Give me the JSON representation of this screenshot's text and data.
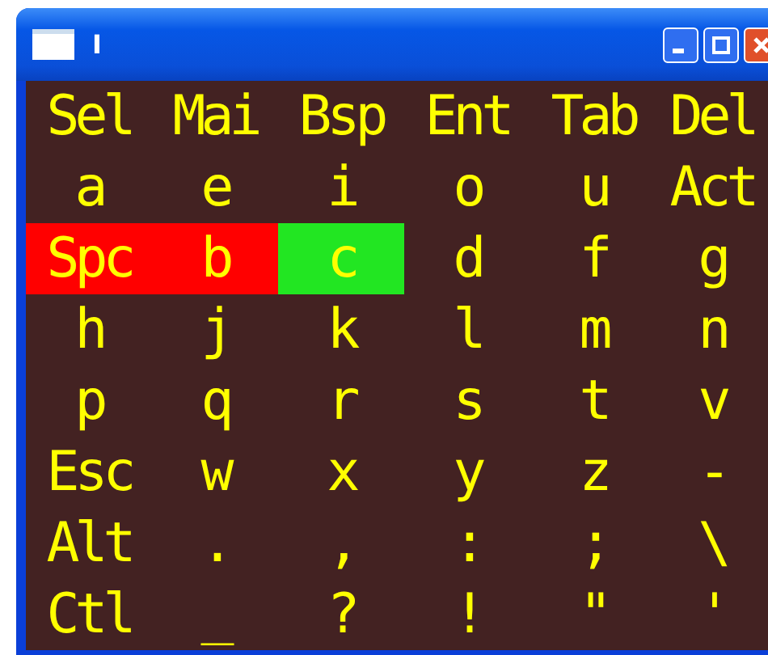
{
  "window": {
    "title": "I"
  },
  "rows": [
    {
      "cells": [
        {
          "text": "Sel"
        },
        {
          "text": "Mai"
        },
        {
          "text": "Bsp"
        },
        {
          "text": "Ent"
        },
        {
          "text": "Tab"
        },
        {
          "text": "Del"
        }
      ]
    },
    {
      "cells": [
        {
          "text": "a"
        },
        {
          "text": "e"
        },
        {
          "text": "i"
        },
        {
          "text": "o"
        },
        {
          "text": "u"
        },
        {
          "text": "Act"
        }
      ]
    },
    {
      "cells": [
        {
          "text": "Spc",
          "color": "#ff0000"
        },
        {
          "text": "b",
          "color": "#ff0000"
        },
        {
          "text": "c",
          "color": "#22e622"
        },
        {
          "text": "d"
        },
        {
          "text": "f"
        },
        {
          "text": "g"
        }
      ]
    },
    {
      "cells": [
        {
          "text": "h"
        },
        {
          "text": "j"
        },
        {
          "text": "k"
        },
        {
          "text": "l"
        },
        {
          "text": "m"
        },
        {
          "text": "n"
        }
      ]
    },
    {
      "cells": [
        {
          "text": "p"
        },
        {
          "text": "q"
        },
        {
          "text": "r"
        },
        {
          "text": "s"
        },
        {
          "text": "t"
        },
        {
          "text": "v"
        }
      ]
    },
    {
      "cells": [
        {
          "text": "Esc"
        },
        {
          "text": "w"
        },
        {
          "text": "x"
        },
        {
          "text": "y"
        },
        {
          "text": "z"
        },
        {
          "text": "-"
        }
      ]
    },
    {
      "cells": [
        {
          "text": "Alt"
        },
        {
          "text": "."
        },
        {
          "text": ","
        },
        {
          "text": ":"
        },
        {
          "text": ";"
        },
        {
          "text": "\\"
        }
      ]
    },
    {
      "cells": [
        {
          "text": "Ctl"
        },
        {
          "text": "_"
        },
        {
          "text": "?"
        },
        {
          "text": "!"
        },
        {
          "text": "\""
        },
        {
          "text": "'"
        }
      ]
    }
  ]
}
